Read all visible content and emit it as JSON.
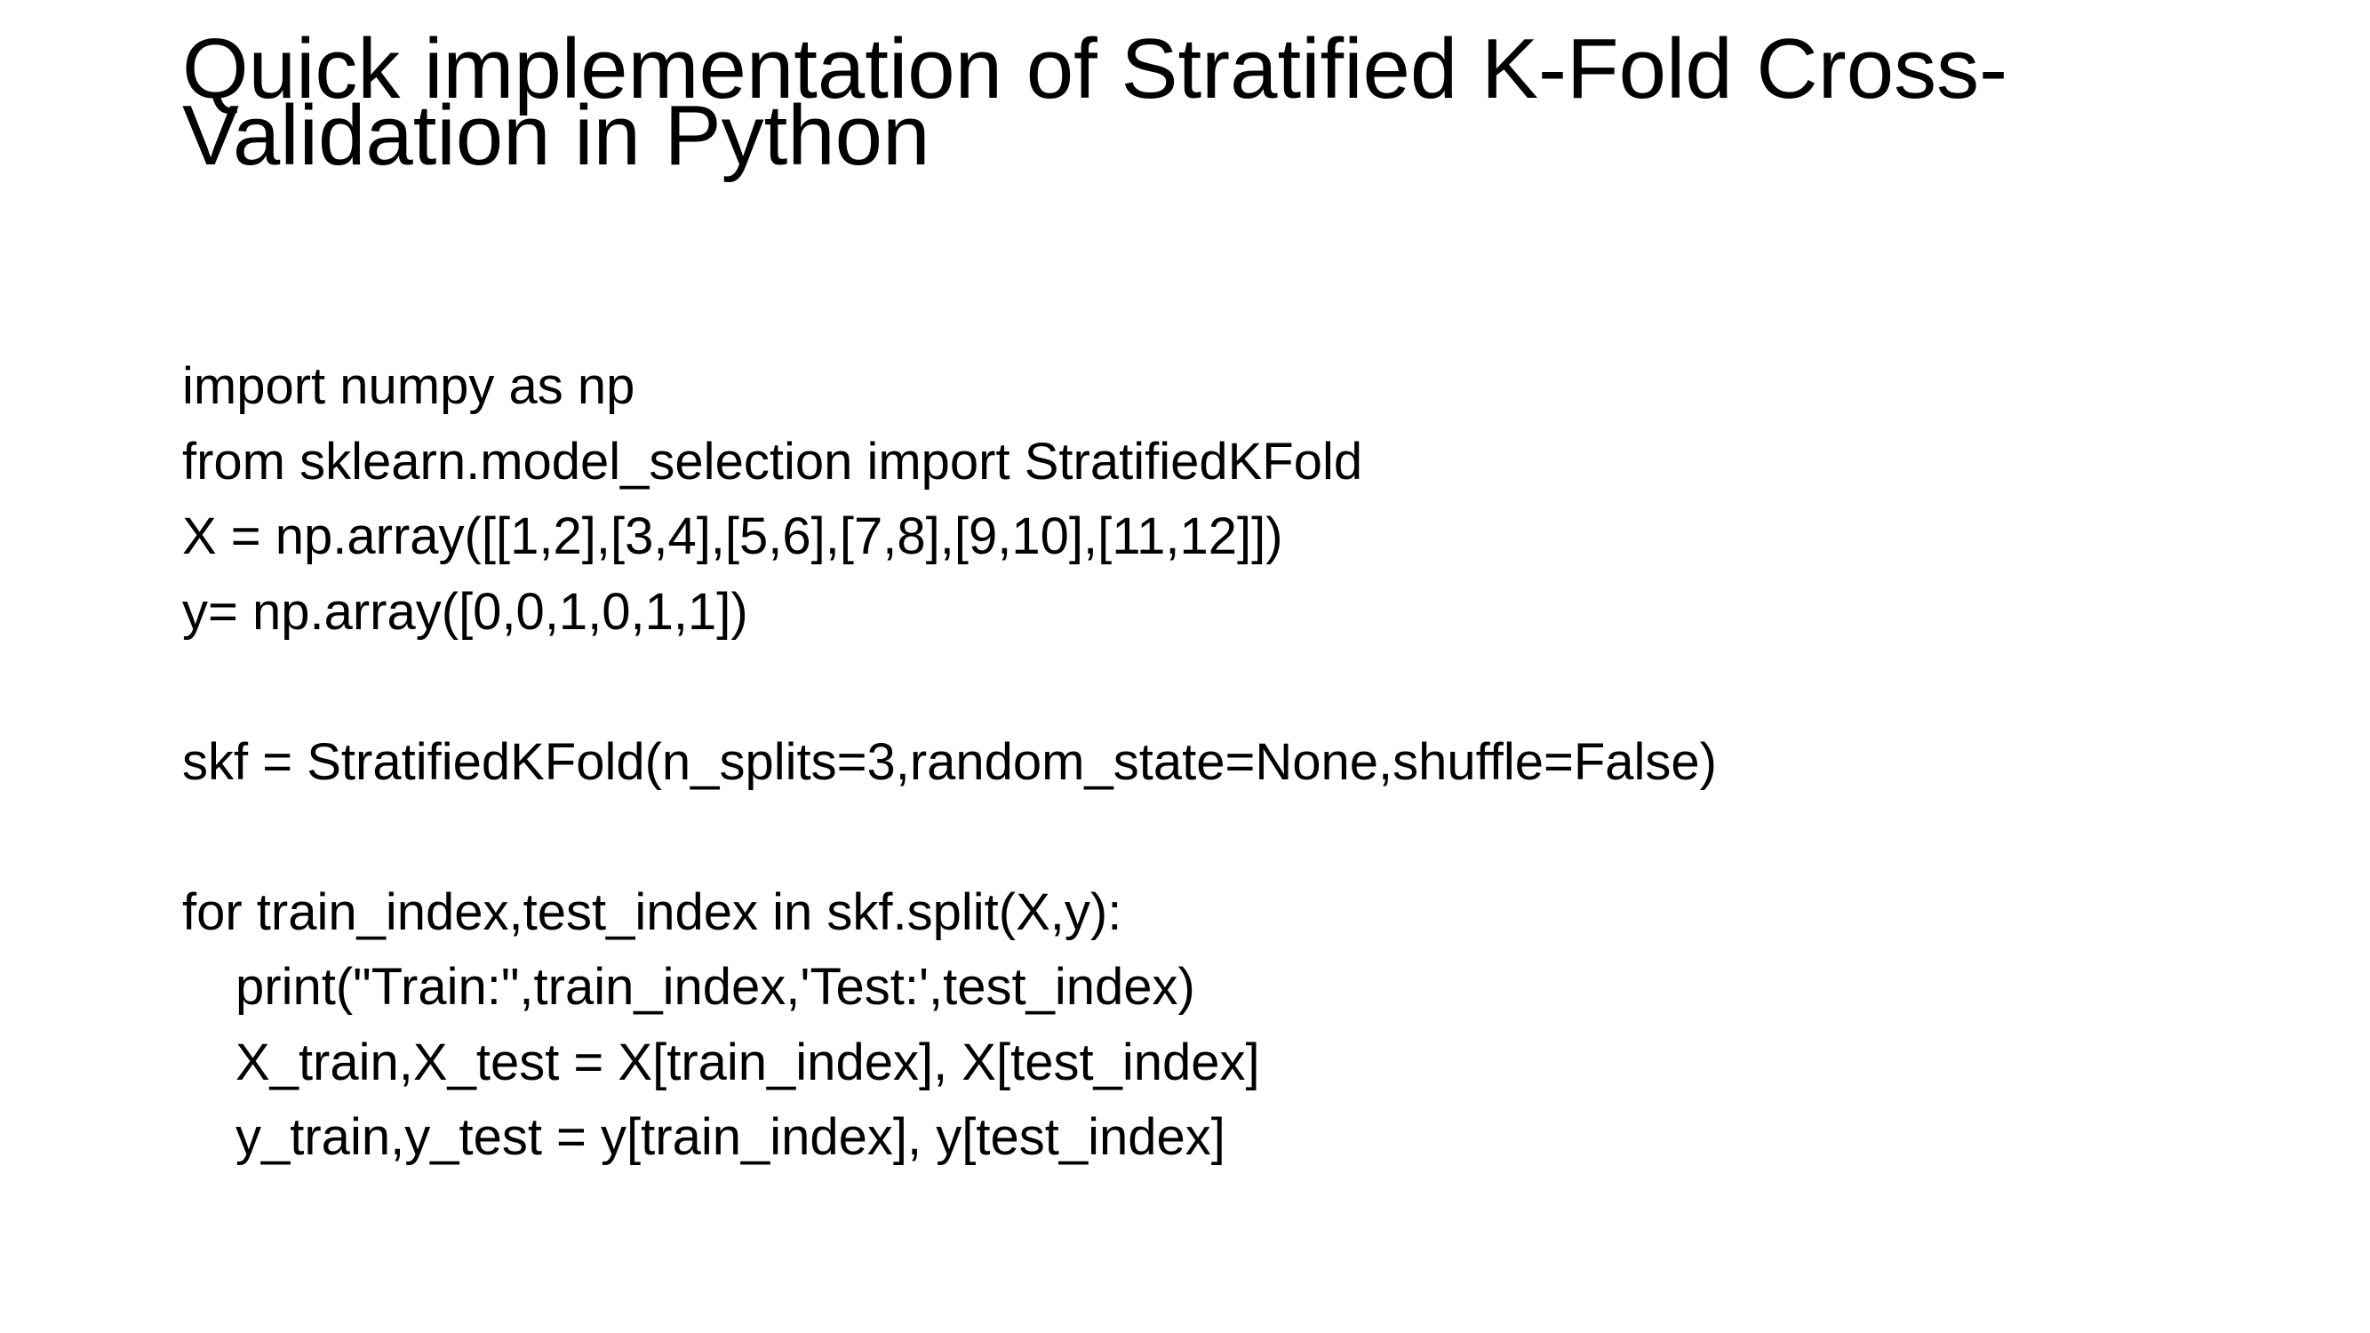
{
  "slide": {
    "title_lines": [
      "Quick implementation of Stratified K-Fold Cross-",
      "Validation in Python"
    ],
    "code_lines": [
      {
        "text": "import numpy as np",
        "indent": false
      },
      {
        "text": "from sklearn.model_selection import StratifiedKFold",
        "indent": false
      },
      {
        "text": "X = np.array([[1,2],[3,4],[5,6],[7,8],[9,10],[11,12]])",
        "indent": false
      },
      {
        "text": "y= np.array([0,0,1,0,1,1])",
        "indent": false
      },
      {
        "text": "",
        "indent": false
      },
      {
        "text": "skf = StratifiedKFold(n_splits=3,random_state=None,shuffle=False)",
        "indent": false
      },
      {
        "text": "",
        "indent": false
      },
      {
        "text": "for train_index,test_index in skf.split(X,y):",
        "indent": false
      },
      {
        "text": "print(\"Train:\",train_index,'Test:',test_index)",
        "indent": true
      },
      {
        "text": "X_train,X_test = X[train_index], X[test_index]",
        "indent": true
      },
      {
        "text": "y_train,y_test = y[train_index], y[test_index]",
        "indent": true
      }
    ]
  }
}
